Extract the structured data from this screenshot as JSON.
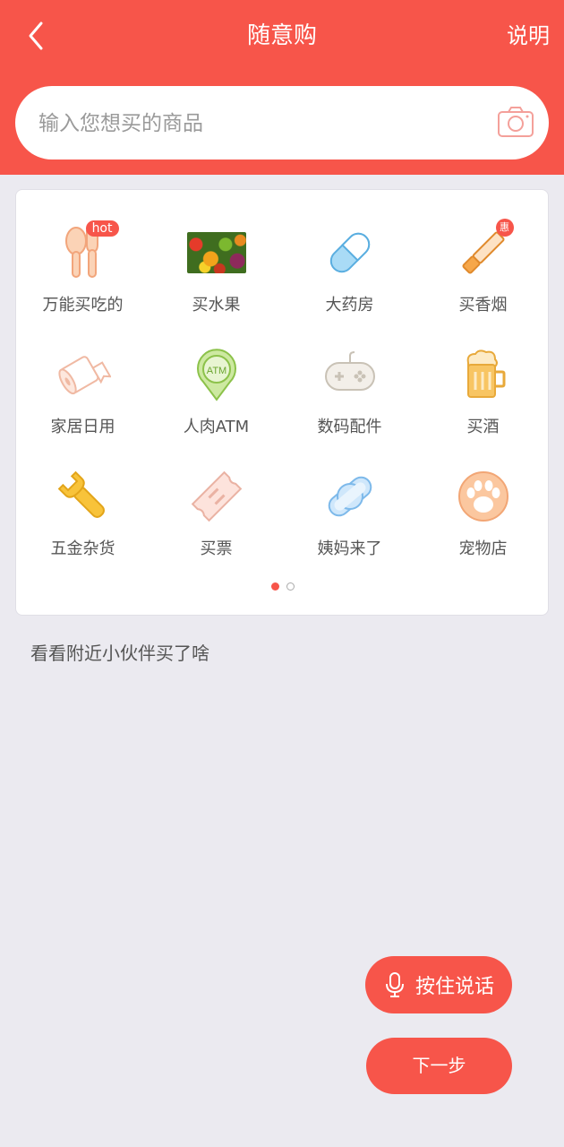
{
  "header": {
    "back_icon": "chevron-left-icon",
    "title": "随意购",
    "explain_label": "说明"
  },
  "search": {
    "placeholder": "输入您想买的商品",
    "value": "",
    "camera_icon": "camera-icon"
  },
  "categories": [
    {
      "label": "万能买吃的",
      "icon": "fork-spoon-icon",
      "badge": "hot"
    },
    {
      "label": "买水果",
      "icon": "fruit-photo"
    },
    {
      "label": "大药房",
      "icon": "pill-icon"
    },
    {
      "label": "买香烟",
      "icon": "cigarette-icon",
      "badge": "惠"
    },
    {
      "label": "家居日用",
      "icon": "toilet-paper-icon"
    },
    {
      "label": "人肉ATM",
      "icon": "atm-pin-icon",
      "icon_text": "ATM"
    },
    {
      "label": "数码配件",
      "icon": "gamepad-icon"
    },
    {
      "label": "买酒",
      "icon": "beer-mug-icon"
    },
    {
      "label": "五金杂货",
      "icon": "wrench-icon"
    },
    {
      "label": "买票",
      "icon": "ticket-icon"
    },
    {
      "label": "姨妈来了",
      "icon": "sanitary-pad-icon"
    },
    {
      "label": "宠物店",
      "icon": "paw-icon"
    }
  ],
  "pagination": {
    "current": 1,
    "total": 2
  },
  "nearby": {
    "label": "看看附近小伙伴买了啥"
  },
  "actions": {
    "voice_label": "按住说话",
    "voice_icon": "microphone-icon",
    "next_label": "下一步"
  },
  "colors": {
    "accent": "#f7554a",
    "background": "#ebeaf0"
  }
}
